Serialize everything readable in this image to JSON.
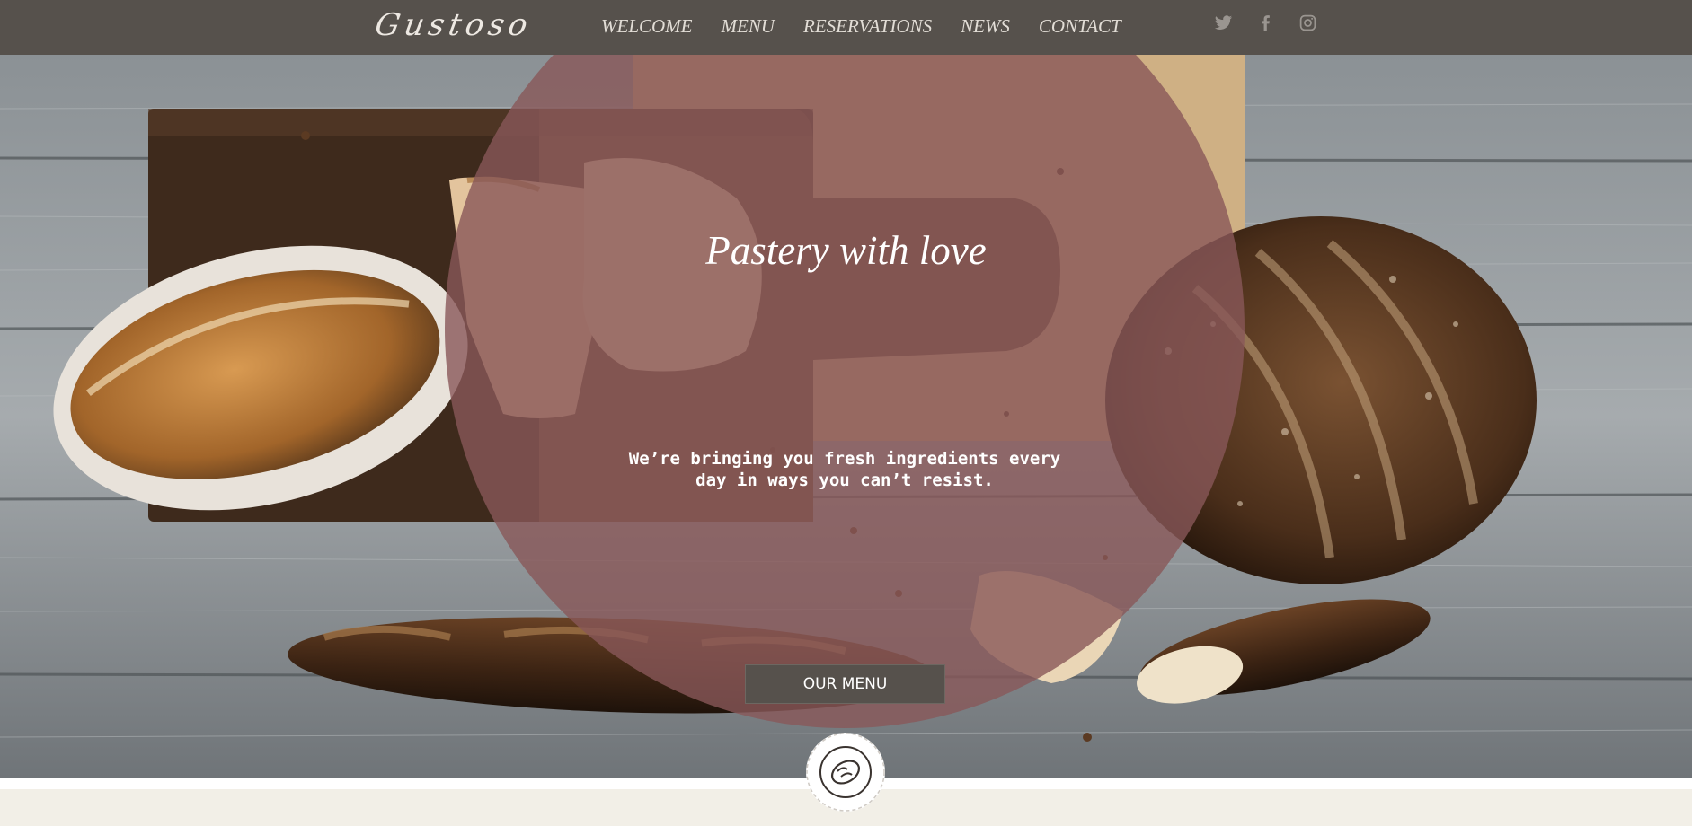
{
  "brand": {
    "name": "Gustoso"
  },
  "nav": {
    "items": [
      {
        "label": "WELCOME"
      },
      {
        "label": "MENU"
      },
      {
        "label": "RESERVATIONS"
      },
      {
        "label": "NEWS"
      },
      {
        "label": "CONTACT"
      }
    ]
  },
  "social": {
    "icons": [
      "twitter-icon",
      "facebook-icon",
      "instagram-icon"
    ]
  },
  "hero": {
    "title": "Pastery with love",
    "tagline": "We’re bringing you fresh ingredients every day in ways you can’t resist.",
    "button_label": "OUR MENU"
  },
  "colors": {
    "header_bg": "#56514c",
    "nav_text": "#e2ddd6",
    "circle_overlay": "#885859",
    "button_bg": "#56514c",
    "lower_band": "#f2efe7"
  }
}
